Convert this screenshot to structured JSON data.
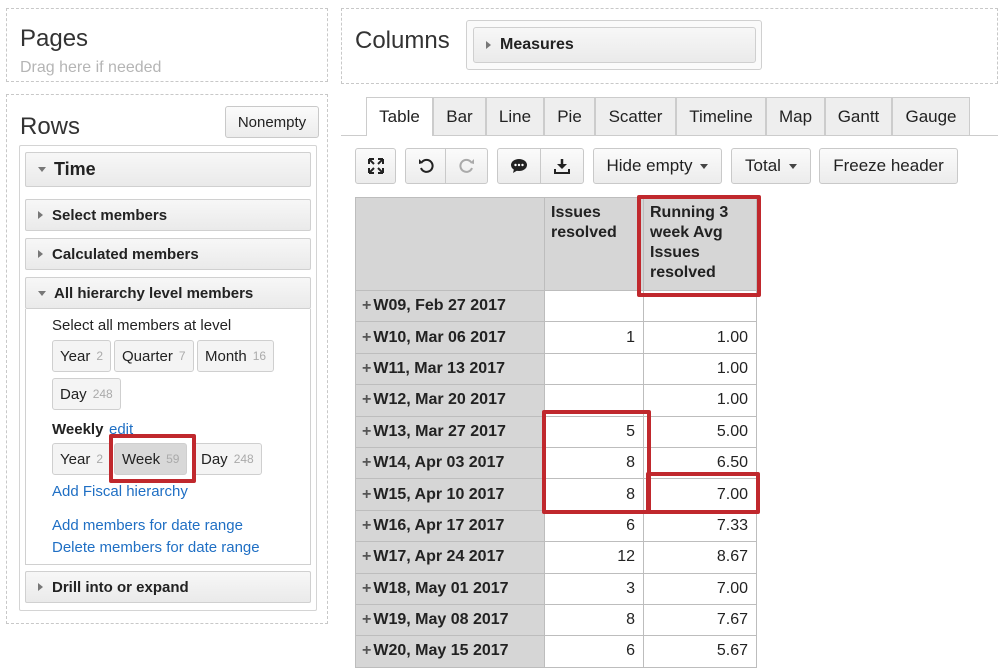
{
  "pages_zone": {
    "title": "Pages",
    "hint": "Drag here if needed"
  },
  "columns_zone": {
    "title": "Columns",
    "measures_label": "Measures"
  },
  "rows_zone": {
    "title": "Rows",
    "nonempty_label": "Nonempty",
    "dimension": "Time",
    "select_members": "Select members",
    "calculated_members": "Calculated members",
    "all_hierarchy_level_members": "All hierarchy level members",
    "select_all_level_text": "Select all members at level",
    "default_levels": [
      {
        "label": "Year",
        "count": "2"
      },
      {
        "label": "Quarter",
        "count": "7"
      },
      {
        "label": "Month",
        "count": "16"
      },
      {
        "label": "Day",
        "count": "248"
      }
    ],
    "weekly_label": "Weekly",
    "weekly_edit": "edit",
    "weekly_levels": [
      {
        "label": "Year",
        "count": "2"
      },
      {
        "label": "Week",
        "count": "59"
      },
      {
        "label": "Day",
        "count": "248"
      }
    ],
    "add_fiscal_hierarchy": "Add Fiscal hierarchy",
    "add_members_date_range": "Add members for date range",
    "delete_members_date_range": "Delete members for date range",
    "drill_into_expand": "Drill into or expand"
  },
  "tabs": [
    "Table",
    "Bar",
    "Line",
    "Pie",
    "Scatter",
    "Timeline",
    "Map",
    "Gantt",
    "Gauge"
  ],
  "active_tab": "Table",
  "toolbar": {
    "icons": [
      "fullscreen-icon",
      "undo-icon",
      "redo-icon",
      "comment-icon",
      "download-icon"
    ],
    "hide_empty": "Hide empty",
    "total": "Total",
    "freeze_header": "Freeze header"
  },
  "table": {
    "headers": [
      "Issues resolved",
      "Running 3 week Avg Issues resolved"
    ],
    "rows": [
      {
        "label": "W09, Feb 27 2017",
        "issues": "",
        "avg": ""
      },
      {
        "label": "W10, Mar 06 2017",
        "issues": "1",
        "avg": "1.00"
      },
      {
        "label": "W11, Mar 13 2017",
        "issues": "",
        "avg": "1.00"
      },
      {
        "label": "W12, Mar 20 2017",
        "issues": "",
        "avg": "1.00"
      },
      {
        "label": "W13, Mar 27 2017",
        "issues": "5",
        "avg": "5.00"
      },
      {
        "label": "W14, Apr 03 2017",
        "issues": "8",
        "avg": "6.50"
      },
      {
        "label": "W15, Apr 10 2017",
        "issues": "8",
        "avg": "7.00"
      },
      {
        "label": "W16, Apr 17 2017",
        "issues": "6",
        "avg": "7.33"
      },
      {
        "label": "W17, Apr 24 2017",
        "issues": "12",
        "avg": "8.67"
      },
      {
        "label": "W18, May 01 2017",
        "issues": "3",
        "avg": "7.00"
      },
      {
        "label": "W19, May 08 2017",
        "issues": "8",
        "avg": "7.67"
      },
      {
        "label": "W20, May 15 2017",
        "issues": "6",
        "avg": "5.67"
      }
    ]
  },
  "highlight_color": "#c0282d"
}
